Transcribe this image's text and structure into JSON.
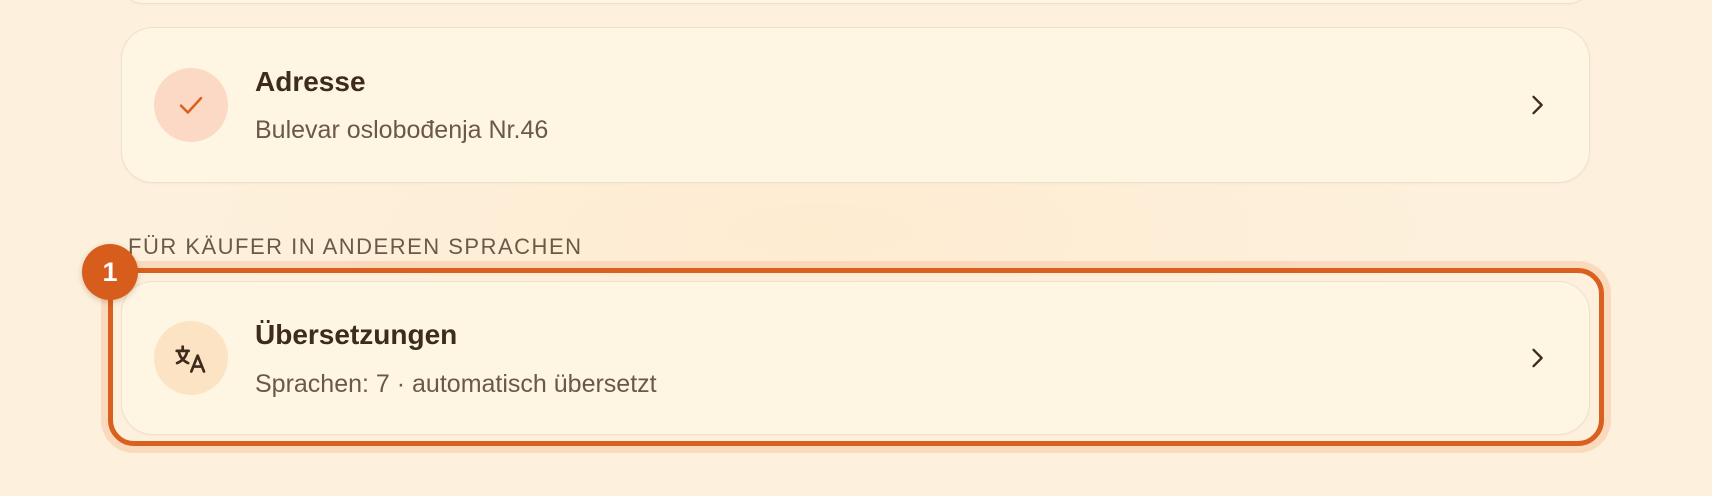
{
  "cards": {
    "address": {
      "title": "Adresse",
      "subtitle": "Bulevar oslobođenja Nr.46",
      "icon": "check-icon"
    },
    "translations": {
      "title": "Übersetzungen",
      "subtitle": "Sprachen: 7 · automatisch übersetzt",
      "icon": "translate-icon"
    }
  },
  "section": {
    "label": "FÜR KÄUFER IN ANDEREN SPRACHEN"
  },
  "annotation": {
    "step_number": "1"
  },
  "colors": {
    "background": "#fdf0dc",
    "card": "#fef5e3",
    "accent": "#d9601f",
    "check_circle": "#fbd9c4",
    "translate_circle": "#fce3c4"
  }
}
